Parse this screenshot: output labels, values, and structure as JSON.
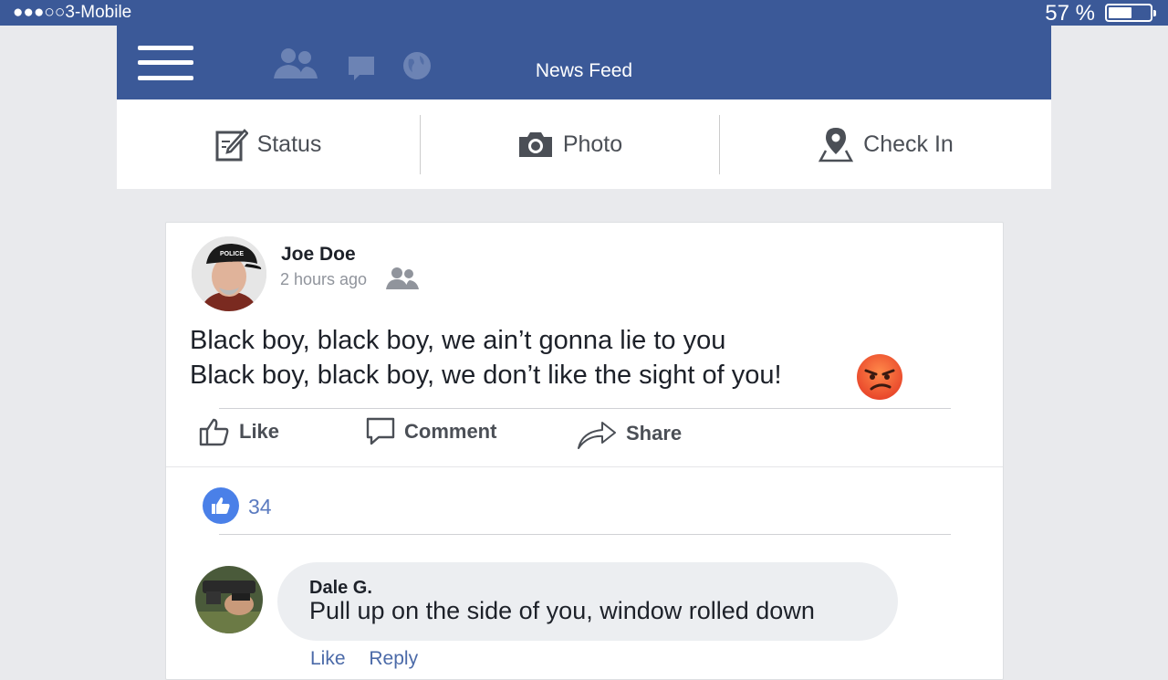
{
  "status_bar": {
    "carrier": "●●●○○3-Mobile",
    "battery_percent": "57 %",
    "battery_level": 0.57
  },
  "nav": {
    "title": "News Feed",
    "icons": [
      "menu-icon",
      "friends-icon",
      "messages-icon",
      "globe-icon"
    ]
  },
  "composer": {
    "status_label": "Status",
    "photo_label": "Photo",
    "checkin_label": "Check In"
  },
  "post": {
    "author": "Joe Doe",
    "timestamp": "2 hours ago",
    "text_line1": "Black boy, black boy, we ain’t gonna lie to you",
    "text_line2": "Black boy, black boy, we don’t like the sight of you!",
    "emoji": "angry-face",
    "actions": {
      "like": "Like",
      "comment": "Comment",
      "share": "Share"
    },
    "like_count": "34"
  },
  "comment": {
    "author": "Dale G.",
    "text": "Pull up on the side of you, window rolled down",
    "like_label": "Like",
    "reply_label": "Reply"
  },
  "colors": {
    "brand": "#3b5998",
    "background": "#e9eaed",
    "like_blue": "#4a80e8"
  }
}
